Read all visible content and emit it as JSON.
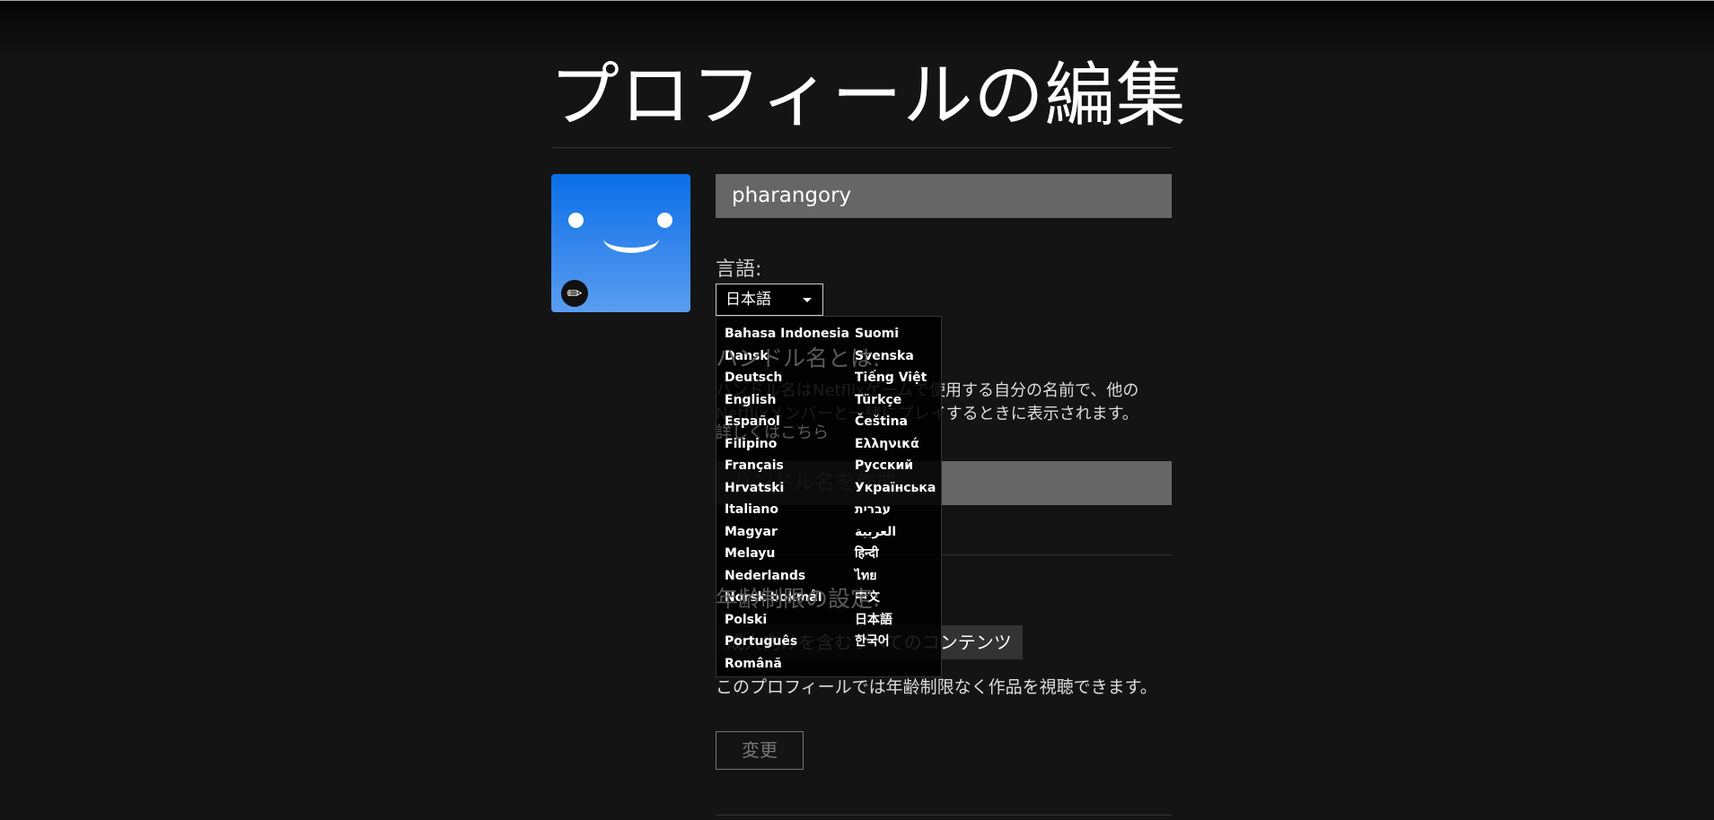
{
  "title": "プロフィールの編集",
  "profile": {
    "name": "pharangory",
    "avatar_color": "#0a6ee8"
  },
  "language": {
    "label": "言語:",
    "selected": "日本語",
    "options_col1": [
      "Bahasa Indonesia",
      "Dansk",
      "Deutsch",
      "English",
      "Español",
      "Filipino",
      "Français",
      "Hrvatski",
      "Italiano",
      "Magyar",
      "Melayu",
      "Nederlands",
      "Norsk bokmål",
      "Polski",
      "Português",
      "Română"
    ],
    "options_col2": [
      "Suomi",
      "Svenska",
      "Tiếng Việt",
      "Türkçe",
      "Čeština",
      "Ελληνικά",
      "Русский",
      "Українська",
      "עברית",
      "العربية",
      "हिन्दी",
      "ไทย",
      "中文",
      "日本語",
      "한국어"
    ]
  },
  "handle": {
    "heading": "ハンドル名とは:",
    "description": "ハンドル名はNetflixゲームで使用する自分の名前で、他のNetflixメンバーと一緒にプレイするときに表示されます。",
    "learn_more": "詳しくはこちら",
    "placeholder": "ハンドル名を作成"
  },
  "maturity": {
    "heading": "年齢制限の設定:",
    "badge": "成人向けを含むすべてのコンテンツ",
    "description": "このプロフィールでは年齢制限なく作品を視聴できます。",
    "change_button": "変更"
  }
}
